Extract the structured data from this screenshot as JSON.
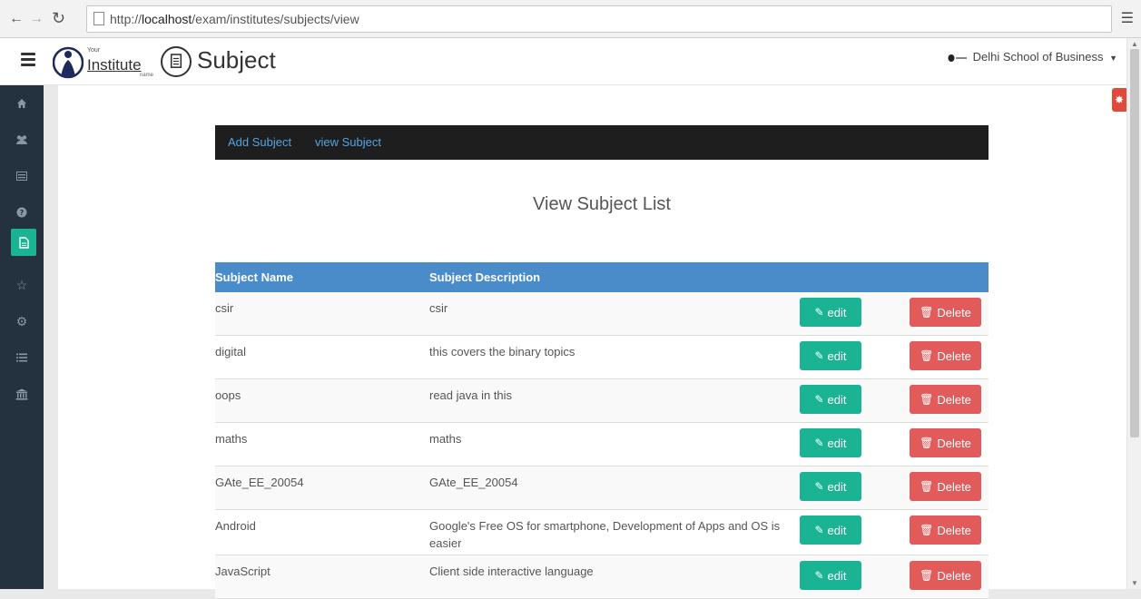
{
  "browser": {
    "url_prefix": "http://",
    "url_host": "localhost",
    "url_path": "/exam/institutes/subjects/view"
  },
  "header": {
    "logo_your": "Your",
    "logo_institute": "Institute",
    "logo_name": "name",
    "page_title": "Subject",
    "org_name": "Delhi School of Business"
  },
  "sidebar": {
    "items": [
      {
        "icon": "home-icon"
      },
      {
        "icon": "users-icon"
      },
      {
        "icon": "list-alt-icon"
      },
      {
        "icon": "question-icon"
      },
      {
        "icon": "file-icon",
        "active": true
      },
      {
        "icon": "star-icon"
      },
      {
        "icon": "gear-icon"
      },
      {
        "icon": "list-icon"
      },
      {
        "icon": "institution-icon"
      }
    ]
  },
  "subnav": {
    "add_label": "Add Subject",
    "view_label": "view Subject"
  },
  "main": {
    "list_title": "View Subject List",
    "columns": [
      "Subject Name",
      "Subject Description"
    ],
    "edit_label": "edit",
    "delete_label": "Delete",
    "rows": [
      {
        "name": "csir",
        "description": "csir"
      },
      {
        "name": "digital",
        "description": "this covers the binary topics"
      },
      {
        "name": "oops",
        "description": "read java in this"
      },
      {
        "name": "maths",
        "description": "maths"
      },
      {
        "name": "GAte_EE_20054",
        "description": "GAte_EE_20054"
      },
      {
        "name": "Android",
        "description": "Google's Free OS for smartphone, Development of Apps and OS is easier"
      },
      {
        "name": "JavaScript",
        "description": "Client side interactive language"
      }
    ]
  },
  "colors": {
    "sidebar_bg": "#24313f",
    "accent_green": "#1ab394",
    "delete_red": "#e15b5b",
    "table_head_blue": "#4a8bc9",
    "subnav_link": "#52a5e2"
  }
}
